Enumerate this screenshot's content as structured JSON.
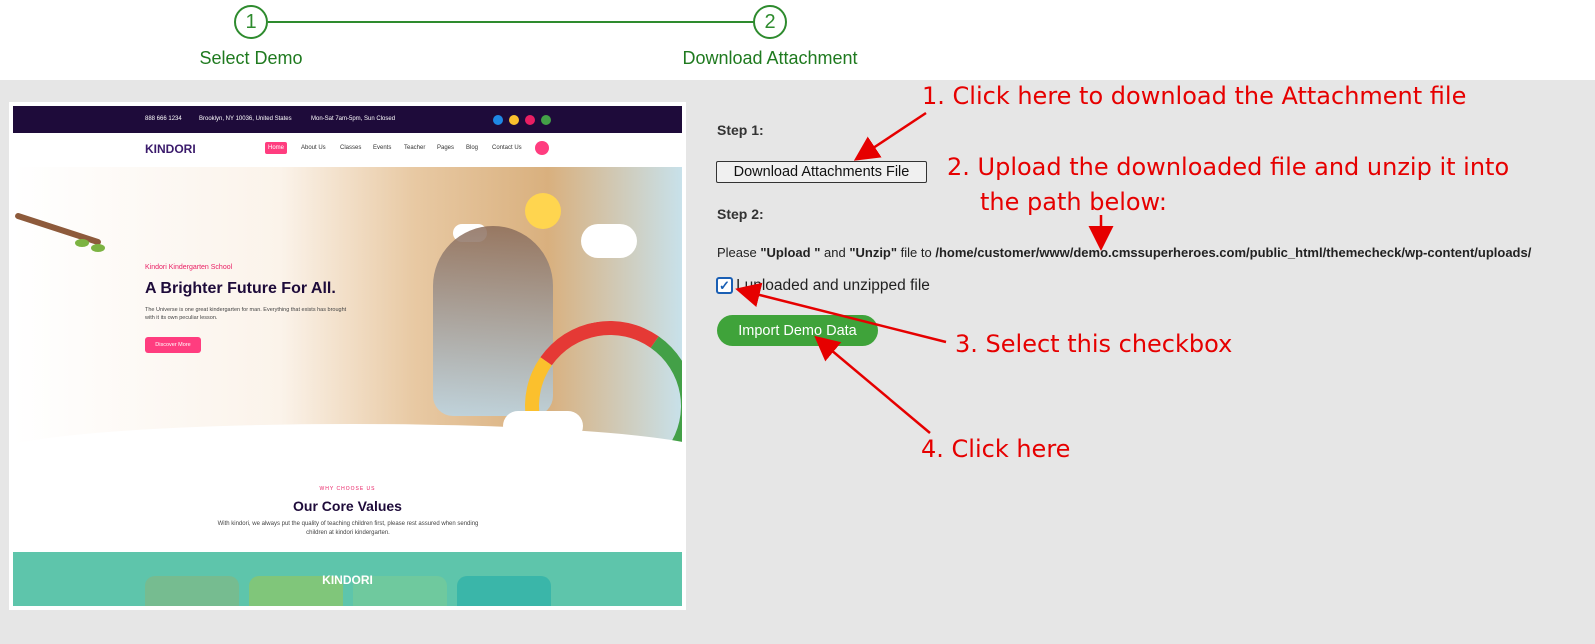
{
  "stepper": {
    "steps": [
      {
        "number": "1",
        "label": "Select Demo"
      },
      {
        "number": "2",
        "label": "Download Attachment"
      }
    ]
  },
  "preview": {
    "topbar": {
      "phone": "888 666 1234",
      "address": "Brooklyn, NY 10036, United States",
      "hours": "Mon-Sat 7am-5pm, Sun Closed"
    },
    "logo": "KINDORI",
    "nav": [
      "Home",
      "About Us",
      "Classes",
      "Events",
      "Teacher",
      "Pages",
      "Blog",
      "Contact Us"
    ],
    "hero": {
      "subtitle": "Kindori Kindergarten School",
      "title": "A Brighter Future For All.",
      "text": "The Universe is one great kindergarten for man. Everything that exists has brought with it its own peculiar lesson.",
      "button": "Discover More"
    },
    "section": {
      "eyebrow": "WHY CHOOSE US",
      "title": "Our Core Values",
      "text": "With kindori, we always put the quality of teaching children first, please rest assured when sending children at kindori kindergarten."
    },
    "footer_title": "KINDORI"
  },
  "panel": {
    "step1_heading": "Step 1:",
    "download_button": "Download Attachments File",
    "step2_heading": "Step 2:",
    "instruction_prefix": "Please",
    "upload_word": "\"Upload \"",
    "and_word": "and",
    "unzip_word": "\"Unzip\"",
    "file_to": "file to",
    "path": "/home/customer/www/demo.cmssuperheroes.com/public_html/themecheck/wp-content/uploads/",
    "checkbox_label": "I uploaded and unzipped file",
    "checkbox_checked": true,
    "import_button": "Import Demo Data"
  },
  "annotations": {
    "a1": "1. Click here to download the Attachment file",
    "a2_line1": "2. Upload the downloaded file and unzip it into",
    "a2_line2": "the path below:",
    "a3": "3. Select this checkbox",
    "a4": "4. Click here"
  },
  "colors": {
    "step_green": "#2e8b2e",
    "annotation_red": "#e60000",
    "import_green": "#3fa33a",
    "brand_pink": "#ff3d7f",
    "footer_teal": "#5ec5ab"
  }
}
